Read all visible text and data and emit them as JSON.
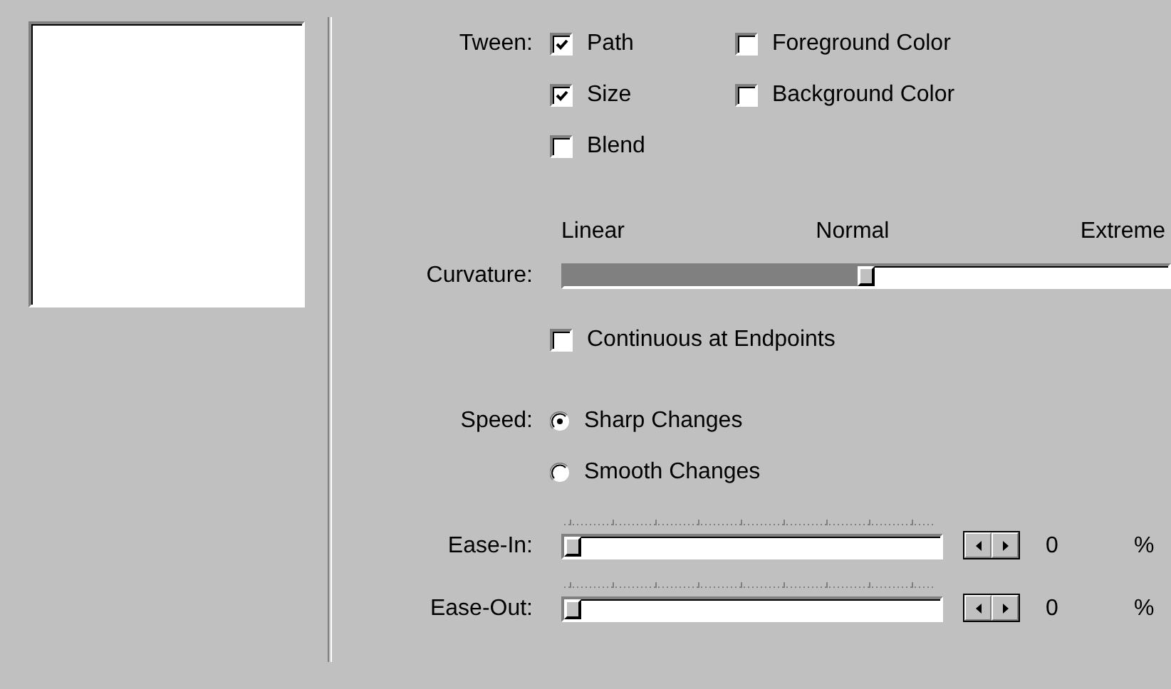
{
  "tween": {
    "label": "Tween:",
    "options": [
      {
        "label": "Path",
        "checked": true
      },
      {
        "label": "Foreground Color",
        "checked": false
      },
      {
        "label": "Size",
        "checked": true
      },
      {
        "label": "Background Color",
        "checked": false
      },
      {
        "label": "Blend",
        "checked": false
      }
    ]
  },
  "curvature": {
    "label": "Curvature:",
    "scale_labels": [
      "Linear",
      "Normal",
      "Extreme"
    ],
    "level": 0.5
  },
  "continuous": {
    "label": "Continuous at Endpoints",
    "checked": false
  },
  "speed": {
    "label": "Speed:",
    "options": [
      {
        "label": "Sharp Changes",
        "selected": true
      },
      {
        "label": "Smooth Changes",
        "selected": false
      }
    ]
  },
  "ease": [
    {
      "label": "Ease-In:",
      "level": 0,
      "value": "0",
      "unit": "%"
    },
    {
      "label": "Ease-Out:",
      "level": 0,
      "value": "0",
      "unit": "%"
    }
  ]
}
